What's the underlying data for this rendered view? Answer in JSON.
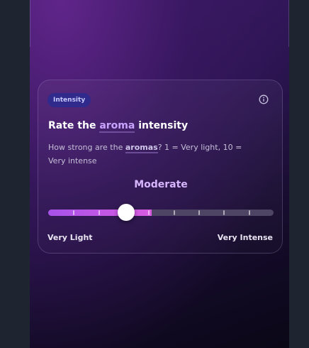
{
  "card": {
    "badge": "Intensity",
    "title_prefix": "Rate the ",
    "title_highlight": "aroma",
    "title_suffix": " intensity",
    "desc_prefix": "How strong are the ",
    "desc_highlight": "aromas",
    "desc_suffix": "? 1 = Very light, 10 = Very intense",
    "value_label": "Moderate",
    "min_label": "Very Light",
    "max_label": "Very Intense",
    "info_icon": "info-icon"
  },
  "slider": {
    "min": 1,
    "max": 10,
    "value": 4,
    "fill_start_color": "#a752ea",
    "fill_end_color": "#d85ce0",
    "track_color": "#4e4565"
  },
  "colors": {
    "accent": "#c9a4ff",
    "badge_bg": "#2f2a8c"
  }
}
